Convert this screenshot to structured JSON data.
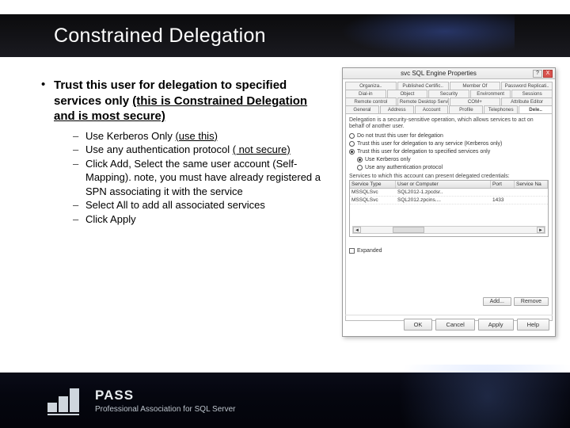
{
  "title": "Constrained Delegation",
  "main_bullet": {
    "pre": "Trust this user for delegation to specified services only ",
    "under": "(this is Constrained Delegation and is most secure)"
  },
  "subs": [
    {
      "pre": "Use Kerberos Only ",
      "under": "(use this)",
      "post": ""
    },
    {
      "pre": "Use any authentication protocol ",
      "under": "( not secure)",
      "post": ""
    },
    {
      "pre": "",
      "under": "",
      "post": "Click Add, Select the same user account (Self-Mapping). note, you must have already registered a SPN associating it with the service"
    },
    {
      "pre": "",
      "under": "",
      "post": "Select All to add all associated services"
    },
    {
      "pre": "",
      "under": "",
      "post": "Click Apply"
    }
  ],
  "dialog": {
    "title": "svc SQL Engine Properties",
    "help": "?",
    "close": "X",
    "tab_rows": [
      [
        "Organiza..",
        "Published Certific..",
        "Member Of",
        "Password Replicati.."
      ],
      [
        "Dial-in",
        "Object",
        "Security",
        "Environment",
        "Sessions"
      ],
      [
        "Remote control",
        "Remote Desktop Services Profile",
        "COM+",
        "Attribute Editor"
      ],
      [
        "General",
        "Address",
        "Account",
        "Profile",
        "Telephones",
        "Dele.."
      ]
    ],
    "active_tab": "Dele..",
    "desc": "Delegation is a security-sensitive operation, which allows services to act on behalf of another user.",
    "radios": [
      {
        "label": "Do not trust this user for delegation",
        "checked": false
      },
      {
        "label": "Trust this user for delegation to any service (Kerberos only)",
        "checked": false
      },
      {
        "label": "Trust this user for delegation to specified services only",
        "checked": true
      }
    ],
    "sub_radios": [
      {
        "label": "Use Kerberos only",
        "checked": true
      },
      {
        "label": "Use any authentication protocol",
        "checked": false
      }
    ],
    "svc_label": "Services to which this account can present delegated credentials:",
    "svc_headers": [
      "Service Type",
      "User or Computer",
      "Port",
      "Service Na"
    ],
    "svc_rows": [
      [
        "MSSQLSvc",
        "SQL2012-1.zpcdsr..",
        "",
        ""
      ],
      [
        "MSSQLSvc",
        "SQL2012.zpcins....",
        "1433",
        ""
      ]
    ],
    "expanded": "Expanded",
    "add": "Add...",
    "remove": "Remove",
    "ok": "OK",
    "cancel": "Cancel",
    "apply": "Apply",
    "help_btn": "Help"
  },
  "footer": {
    "brand": "PASS",
    "tag": "Professional Association for SQL Server"
  }
}
